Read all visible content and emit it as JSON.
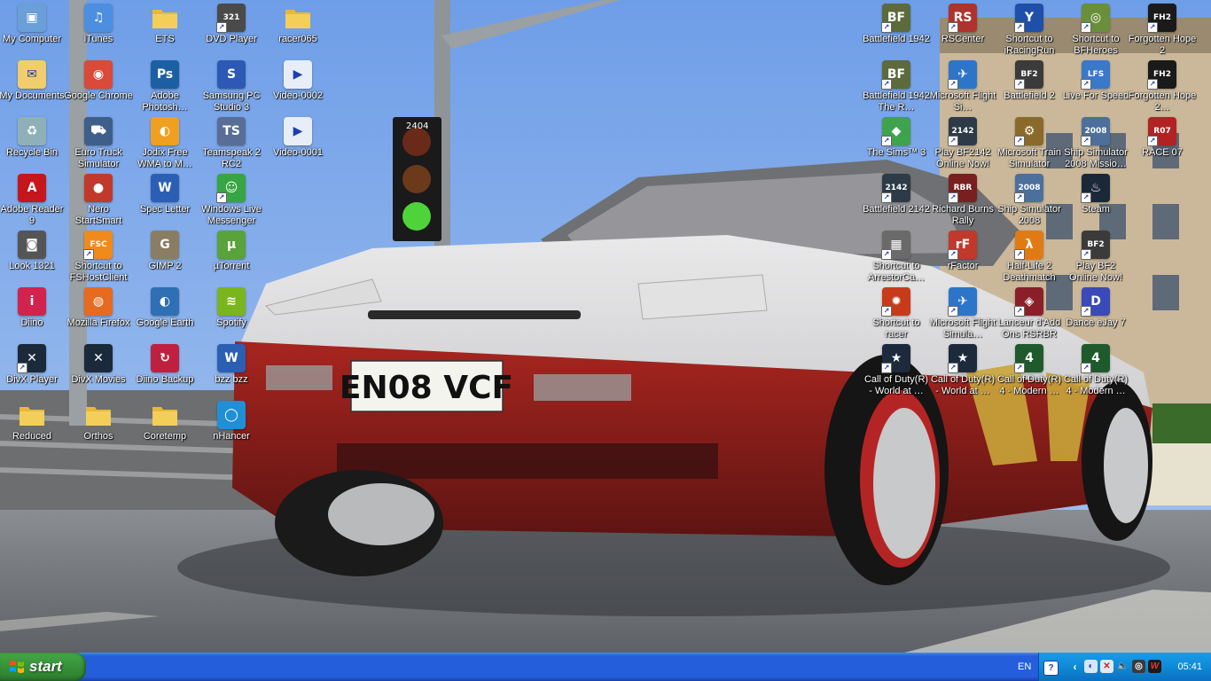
{
  "wallpaper": {
    "plate_text": "EN08 VCF",
    "sign_text": "2404"
  },
  "desktop_icons": [
    {
      "label": "My Computer",
      "icon": "computer-icon",
      "color": "#6a9fd8",
      "glyph": "▣"
    },
    {
      "label": "iTunes",
      "icon": "itunes-icon",
      "color": "#4c8fe0",
      "glyph": "♫"
    },
    {
      "label": "ETS",
      "icon": "folder-icon",
      "color": "#f3cf5a",
      "glyph": ""
    },
    {
      "label": "DVD Player",
      "icon": "dvd-player-icon",
      "color": "#4a4a4a",
      "glyph": "321"
    },
    {
      "label": "racer065",
      "icon": "folder-icon",
      "color": "#f3cf5a",
      "glyph": ""
    },
    {
      "label": "My Documents",
      "icon": "documents-folder-icon",
      "color": "#f2cd6b",
      "glyph": "✉"
    },
    {
      "label": "Google Chrome",
      "icon": "chrome-icon",
      "color": "#d94a38",
      "glyph": "◉"
    },
    {
      "label": "Adobe Photosh…",
      "icon": "photoshop-icon",
      "color": "#1d5fa3",
      "glyph": "Ps"
    },
    {
      "label": "Samsung PC Studio 3",
      "icon": "samsung-icon",
      "color": "#2c59b3",
      "glyph": "S"
    },
    {
      "label": "Video-0002",
      "icon": "video-file-icon",
      "color": "#e8eef8",
      "glyph": "▶"
    },
    {
      "label": "Recycle Bin",
      "icon": "recycle-bin-icon",
      "color": "#8fb0b8",
      "glyph": "♻"
    },
    {
      "label": "Euro Truck Simulator",
      "icon": "truck-icon",
      "color": "#3d5f8a",
      "glyph": "⛟"
    },
    {
      "label": "Jodix Free WMA to M…",
      "icon": "jodix-icon",
      "color": "#f0a020",
      "glyph": "◐"
    },
    {
      "label": "Teamspeak 2 RC2",
      "icon": "teamspeak-icon",
      "color": "#586e96",
      "glyph": "TS"
    },
    {
      "label": "Video-0001",
      "icon": "video-file-icon",
      "color": "#e8eef8",
      "glyph": "▶"
    },
    {
      "label": "Adobe Reader 9",
      "icon": "adobe-reader-icon",
      "color": "#c4161c",
      "glyph": "A"
    },
    {
      "label": "Nero StartSmart",
      "icon": "nero-icon",
      "color": "#c0392b",
      "glyph": "●"
    },
    {
      "label": "Spec Letter",
      "icon": "word-document-icon",
      "color": "#2b5fb4",
      "glyph": "W"
    },
    {
      "label": "Windows Live Messenger",
      "icon": "messenger-icon",
      "color": "#36a542",
      "glyph": "☺"
    },
    {
      "label": "Look 1321",
      "icon": "camera-icon",
      "color": "#555555",
      "glyph": "◙"
    },
    {
      "label": "Shortcut to FSHostClient",
      "icon": "fshost-icon",
      "color": "#f08a1c",
      "glyph": "FSC"
    },
    {
      "label": "GIMP 2",
      "icon": "gimp-icon",
      "color": "#8a7d63",
      "glyph": "G"
    },
    {
      "label": "µTorrent",
      "icon": "utorrent-icon",
      "color": "#5aa23a",
      "glyph": "µ"
    },
    {
      "label": "Diino",
      "icon": "diino-icon",
      "color": "#d2234f",
      "glyph": "i"
    },
    {
      "label": "Mozilla Firefox",
      "icon": "firefox-icon",
      "color": "#e66a1f",
      "glyph": "◍"
    },
    {
      "label": "Google Earth",
      "icon": "google-earth-icon",
      "color": "#2f6fb3",
      "glyph": "◐"
    },
    {
      "label": "Spotify",
      "icon": "spotify-icon",
      "color": "#7ab51d",
      "glyph": "≋"
    },
    {
      "label": "DivX Player",
      "icon": "divx-icon",
      "color": "#1a2a3a",
      "glyph": "✕"
    },
    {
      "label": "DivX Movies",
      "icon": "divx-movies-icon",
      "color": "#1a2a3a",
      "glyph": "✕"
    },
    {
      "label": "Diino Backup",
      "icon": "diino-backup-icon",
      "color": "#c02040",
      "glyph": "↻"
    },
    {
      "label": "bzz bzz",
      "icon": "word-document-icon",
      "color": "#2b5fb4",
      "glyph": "W"
    },
    {
      "label": "Reduced",
      "icon": "folder-icon",
      "color": "#f3cf5a",
      "glyph": ""
    },
    {
      "label": "Orthos",
      "icon": "folder-icon",
      "color": "#f3cf5a",
      "glyph": ""
    },
    {
      "label": "Coretemp",
      "icon": "folder-icon",
      "color": "#f3cf5a",
      "glyph": ""
    },
    {
      "label": "nHancer",
      "icon": "nhancer-icon",
      "color": "#1f8fd6",
      "glyph": "◯"
    },
    {
      "label": "Battlefield 1942",
      "icon": "battlefield-1942-icon",
      "color": "#5c6a3c",
      "glyph": "BF"
    },
    {
      "label": "RSCenter",
      "icon": "rscenter-icon",
      "color": "#b0322c",
      "glyph": "RS"
    },
    {
      "label": "Shortcut to iRacingRun",
      "icon": "iracing-icon",
      "color": "#1f4fa8",
      "glyph": "Y"
    },
    {
      "label": "Shortcut to BFHeroes",
      "icon": "bfheroes-icon",
      "color": "#6a8f3a",
      "glyph": "◎"
    },
    {
      "label": "Forgotten Hope 2",
      "icon": "forgotten-hope-icon",
      "color": "#1a1a1a",
      "glyph": "FH2"
    },
    {
      "label": "Battlefield 1942 The R…",
      "icon": "battlefield-1942-icon",
      "color": "#5c6a3c",
      "glyph": "BF"
    },
    {
      "label": "Microsoft Flight Si…",
      "icon": "flight-sim-icon",
      "color": "#2d75c9",
      "glyph": "✈"
    },
    {
      "label": "Battlefield 2",
      "icon": "battlefield-2-icon",
      "color": "#3b3b3b",
      "glyph": "BF2"
    },
    {
      "label": "Live For Speed",
      "icon": "lfs-icon",
      "color": "#3a78c8",
      "glyph": "LFS"
    },
    {
      "label": "Forgotten Hope 2…",
      "icon": "forgotten-hope-icon",
      "color": "#1a1a1a",
      "glyph": "FH2"
    },
    {
      "label": "The Sims™ 3",
      "icon": "sims-icon",
      "color": "#3fa34d",
      "glyph": "◆"
    },
    {
      "label": "Play BF2142 Online Now!",
      "icon": "bf2142-icon",
      "color": "#2d3a48",
      "glyph": "2142"
    },
    {
      "label": "Microsoft Train Simulator",
      "icon": "train-sim-icon",
      "color": "#8a6a2a",
      "glyph": "⚙"
    },
    {
      "label": "Ship Simulator 2008 Missio…",
      "icon": "ship-sim-icon",
      "color": "#4c6f9c",
      "glyph": "2008"
    },
    {
      "label": "RACE 07",
      "icon": "race07-icon",
      "color": "#b22222",
      "glyph": "R07"
    },
    {
      "label": "Battlefield 2142",
      "icon": "bf2142-icon",
      "color": "#2d3a48",
      "glyph": "2142"
    },
    {
      "label": "Richard Burns Rally",
      "icon": "rbr-icon",
      "color": "#7a1f1f",
      "glyph": "RBR"
    },
    {
      "label": "Ship Simulator 2008",
      "icon": "ship-sim-icon",
      "color": "#4c6f9c",
      "glyph": "2008"
    },
    {
      "label": "Steam",
      "icon": "steam-icon",
      "color": "#1b2838",
      "glyph": "♨"
    },
    {
      "label": "Shortcut to ArrestorCa…",
      "icon": "arrestor-icon",
      "color": "#6a6a6a",
      "glyph": "▦"
    },
    {
      "label": "rFactor",
      "icon": "rfactor-icon",
      "color": "#c0392b",
      "glyph": "rF"
    },
    {
      "label": "Half-Life 2 Deathmatch",
      "icon": "half-life-icon",
      "color": "#e07b14",
      "glyph": "λ"
    },
    {
      "label": "Play BF2 Online Now!",
      "icon": "battlefield-2-icon",
      "color": "#3b3b3b",
      "glyph": "BF2"
    },
    {
      "label": "Shortcut to racer",
      "icon": "racer-icon",
      "color": "#c73b1b",
      "glyph": "✹"
    },
    {
      "label": "Microsoft Flight Simula…",
      "icon": "flight-sim-icon",
      "color": "#2d75c9",
      "glyph": "✈"
    },
    {
      "label": "Lanceur d'Add Ons RSRBR",
      "icon": "rsrbr-icon",
      "color": "#8a1f2a",
      "glyph": "◈"
    },
    {
      "label": "Dance eJay 7",
      "icon": "dance-ejay-icon",
      "color": "#3a4ab8",
      "glyph": "D"
    },
    {
      "label": "Call of Duty(R) - World at …",
      "icon": "cod-waw-icon",
      "color": "#1c2a3c",
      "glyph": "★"
    },
    {
      "label": "Call of Duty(R) - World at …",
      "icon": "cod-waw-icon",
      "color": "#1c2a3c",
      "glyph": "★"
    },
    {
      "label": "Call of Duty(R) 4 - Modern …",
      "icon": "cod4-icon",
      "color": "#1f5a2c",
      "glyph": "4"
    },
    {
      "label": "Call of Duty(R) 4 - Modern …",
      "icon": "cod4-icon",
      "color": "#1f5a2c",
      "glyph": "4"
    }
  ],
  "taskbar": {
    "start_label": "start",
    "language": "EN",
    "clock": "05:41"
  }
}
